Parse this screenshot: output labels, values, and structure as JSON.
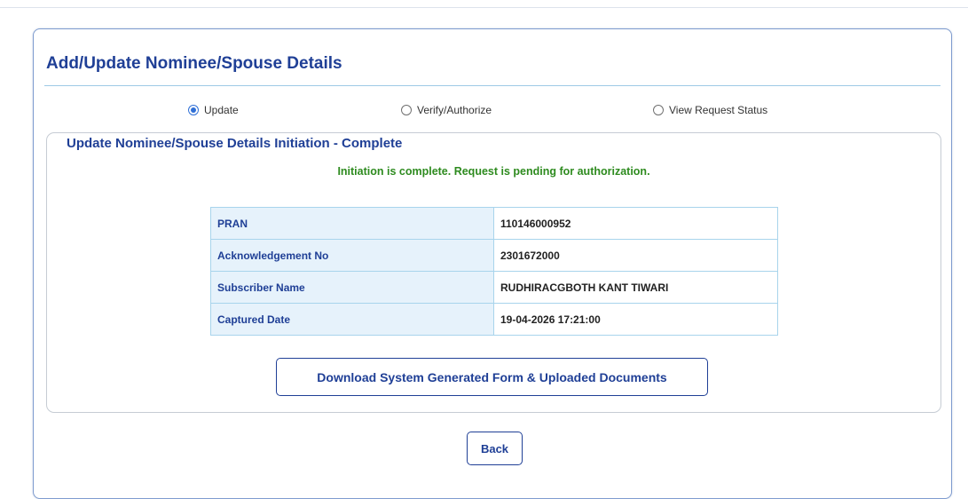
{
  "page": {
    "title": "Add/Update Nominee/Spouse Details"
  },
  "radio_options": [
    {
      "label": "Update",
      "checked": true
    },
    {
      "label": "Verify/Authorize",
      "checked": false
    },
    {
      "label": "View Request Status",
      "checked": false
    }
  ],
  "section": {
    "title": "Update Nominee/Spouse Details Initiation - Complete",
    "message": "Initiation is complete. Request is pending for authorization.",
    "message_color": "#2e8b1f"
  },
  "details": [
    {
      "label": "PRAN",
      "value": "110146000952"
    },
    {
      "label": "Acknowledgement No",
      "value": "2301672000"
    },
    {
      "label": "Subscriber Name",
      "value": "RUDHIRACGBOTH KANT TIWARI"
    },
    {
      "label": "Captured Date",
      "value": "19-04-2026 17:21:00"
    }
  ],
  "buttons": {
    "download_label": "Download System Generated Form & Uploaded Documents",
    "back_label": "Back"
  },
  "colors": {
    "accent": "#1f3f96",
    "radio_selected": "#2f6fd6",
    "table_border": "#a8d4ec",
    "label_bg": "#e6f2fb"
  }
}
